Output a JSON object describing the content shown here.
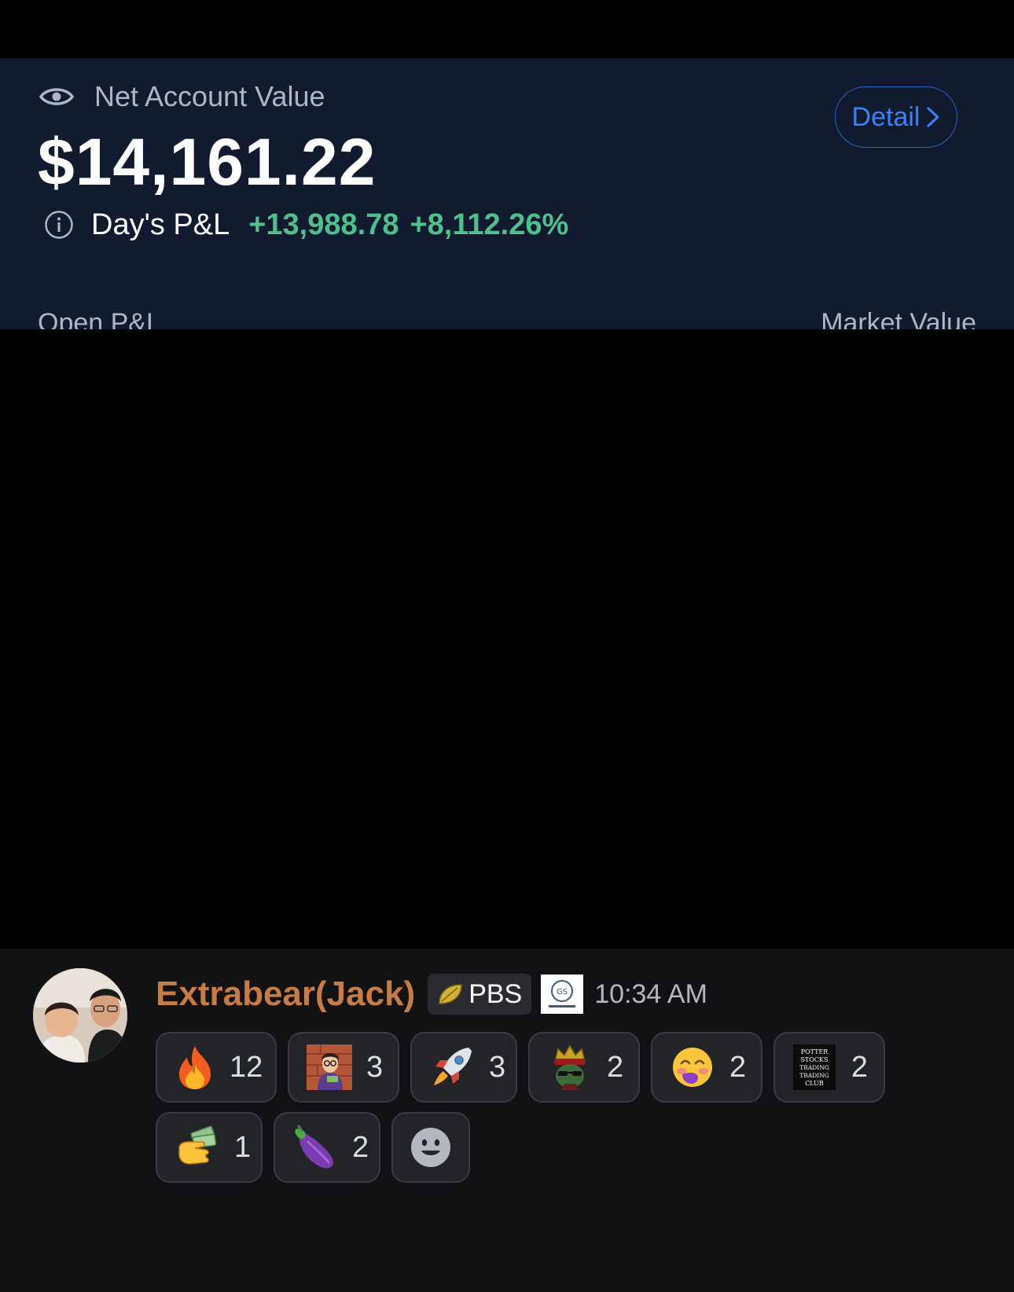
{
  "account": {
    "label": "Net Account Value",
    "value": "$14,161.22",
    "detail_label": "Detail",
    "pl_label": "Day's P&L",
    "pl_amount": "+13,988.78",
    "pl_percent": "+8,112.26%",
    "open_pl_label": "Open P&L",
    "market_value_label": "Market Value"
  },
  "message": {
    "username": "Extrabear(Jack)",
    "role_tag": "PBS",
    "timestamp": "10:34 AM",
    "reactions": [
      {
        "icon": "fire-emoji",
        "glyph": "🔥",
        "count": "12"
      },
      {
        "icon": "custom-potter-emoji",
        "glyph": "",
        "count": "3"
      },
      {
        "icon": "rocket-emoji",
        "glyph": "🚀",
        "count": "3"
      },
      {
        "icon": "custom-king-emoji",
        "glyph": "",
        "count": "2"
      },
      {
        "icon": "blushing-face-emoji",
        "glyph": "☺",
        "count": "2"
      },
      {
        "icon": "custom-potter-stocks-club-emoji",
        "glyph": "",
        "count": "2"
      },
      {
        "icon": "money-hand-emoji",
        "glyph": "",
        "count": "1"
      },
      {
        "icon": "eggplant-emoji",
        "glyph": "",
        "count": "2"
      }
    ],
    "potter_stocks_lines": [
      "POTTER",
      "STOCKS",
      "TRADING",
      "TRADING",
      "CLUB"
    ]
  },
  "colors": {
    "card_bg": "#111a2e",
    "gain_green": "#4fc08d",
    "link_blue": "#3b82f6",
    "username_orange": "#c67c44",
    "chat_bg": "#121214"
  }
}
